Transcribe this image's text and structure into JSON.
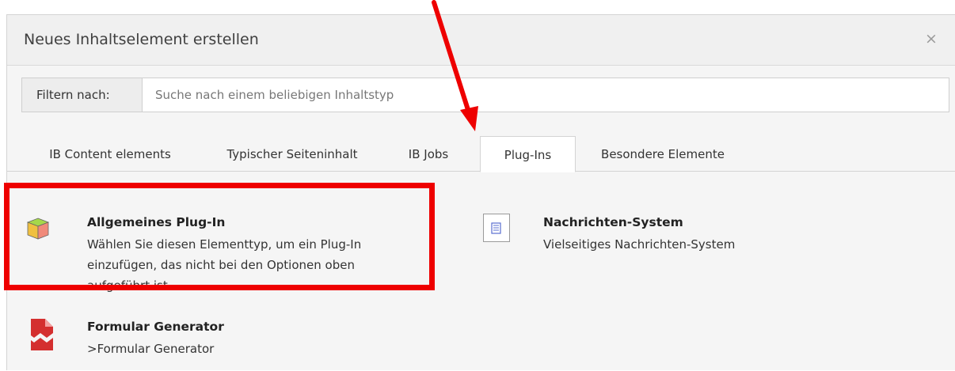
{
  "dialog": {
    "title": "Neues Inhaltselement erstellen",
    "close_label": "×"
  },
  "filter": {
    "label": "Filtern nach:",
    "placeholder": "Suche nach einem beliebigen Inhaltstyp",
    "value": ""
  },
  "tabs": [
    {
      "label": "IB Content elements",
      "active": false
    },
    {
      "label": "Typischer Seiteninhalt",
      "active": false
    },
    {
      "label": "IB Jobs",
      "active": false
    },
    {
      "label": "Plug-Ins",
      "active": true
    },
    {
      "label": "Besondere Elemente",
      "active": false
    }
  ],
  "items": [
    {
      "title": "Allgemeines Plug-In",
      "description_lines": [
        "Wählen Sie diesen Elementtyp, um ein Plug-In",
        "einzufügen, das nicht bei den Optionen oben",
        "aufgeführt ist."
      ],
      "icon": "plugin-cube-icon"
    },
    {
      "title": "Nachrichten-System",
      "description_lines": [
        "Vielseitiges Nachrichten-System"
      ],
      "icon": "news-document-icon"
    },
    {
      "title": "Formular Generator",
      "description_lines": [
        ">Formular Generator"
      ],
      "icon": "form-generator-icon"
    }
  ],
  "annotation": {
    "color": "#ee0000",
    "arrow_points_to": "Plug-Ins tab",
    "highlighted_item": "Allgemeines Plug-In"
  }
}
